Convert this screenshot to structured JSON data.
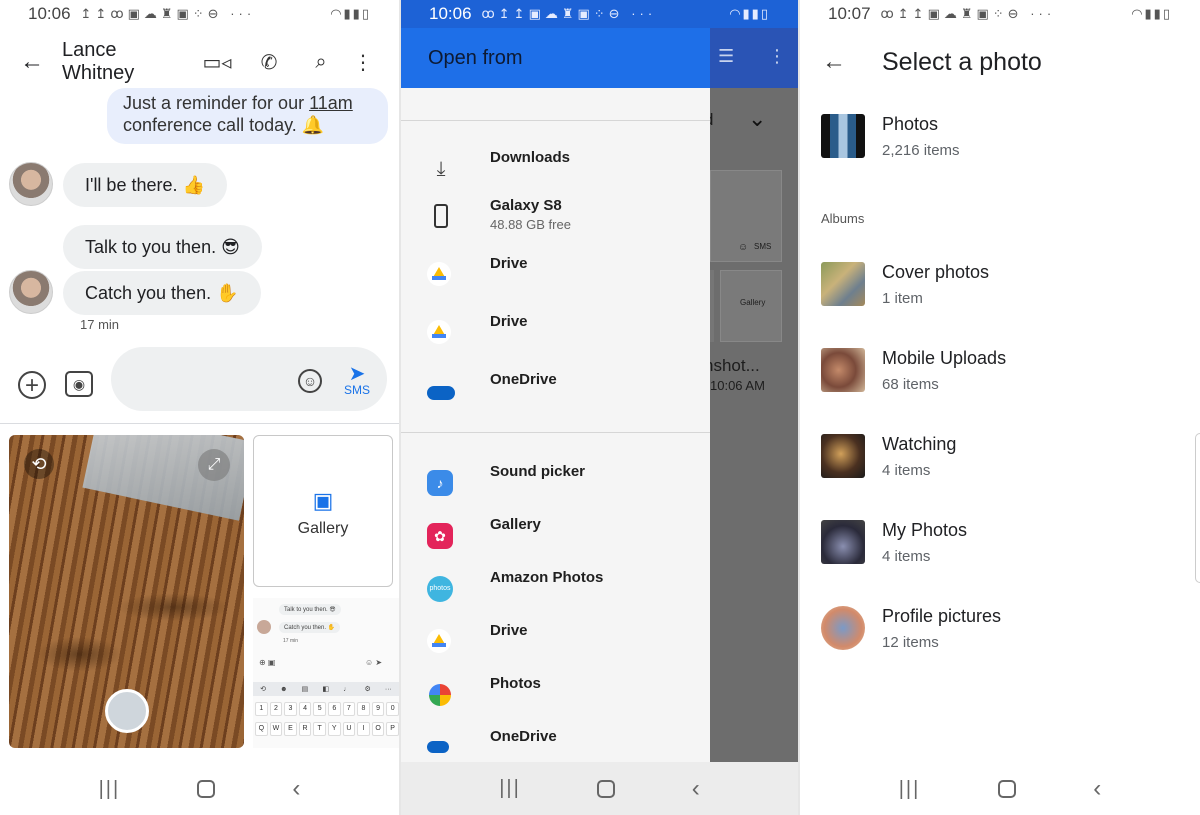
{
  "panel1": {
    "status": {
      "time": "10:06"
    },
    "contact_name": "Lance Whitney",
    "messages": {
      "outgoing_prefix": "Just a reminder for our ",
      "outgoing_link": "11am",
      "outgoing_line2": "conference call today. 🔔",
      "m1": "I'll be there. 👍",
      "m2": "Talk to you then. 😎",
      "m3": "Catch you then. ✋"
    },
    "timestamp": "17 min",
    "send_label": "SMS",
    "gallery_tile_label": "Gallery",
    "thumbnail": {
      "msg1": "Talk to you then. 😎",
      "msg2": "Catch you then. ✋",
      "ts": "17 min",
      "number_keys": [
        "1",
        "2",
        "3",
        "4",
        "5",
        "6",
        "7",
        "8",
        "9",
        "0"
      ],
      "letter_keys": [
        "Q",
        "W",
        "E",
        "R",
        "T",
        "Y",
        "U",
        "I",
        "O",
        "P"
      ]
    }
  },
  "panel2": {
    "status": {
      "time": "10:06"
    },
    "header_title": "Open from",
    "behind_fragments": {
      "d": "d",
      "shot": "nshot...",
      "time": "10:06 AM",
      "gallery": "Gallery",
      "sms": "SMS"
    },
    "items": [
      {
        "label": "Downloads",
        "sub": "",
        "icon": "download-icon"
      },
      {
        "label": "Galaxy S8",
        "sub": "48.88 GB free",
        "icon": "phone-icon"
      },
      {
        "label": "Drive",
        "sub": "",
        "icon": "drive-icon"
      },
      {
        "label": "Drive",
        "sub": "",
        "icon": "drive-icon"
      },
      {
        "label": "OneDrive",
        "sub": "",
        "icon": "onedrive-icon"
      },
      {
        "label": "Sound picker",
        "sub": "",
        "icon": "sound-picker-icon"
      },
      {
        "label": "Gallery",
        "sub": "",
        "icon": "gallery-icon"
      },
      {
        "label": "Amazon Photos",
        "sub": "",
        "icon": "amazon-photos-icon"
      },
      {
        "label": "Drive",
        "sub": "",
        "icon": "drive-icon"
      },
      {
        "label": "Photos",
        "sub": "",
        "icon": "google-photos-icon"
      },
      {
        "label": "OneDrive",
        "sub": "",
        "icon": "onedrive-icon"
      }
    ],
    "amazon_icon_text": "photos"
  },
  "panel3": {
    "status": {
      "time": "10:07"
    },
    "title": "Select a photo",
    "albums_label": "Albums",
    "top_item": {
      "name": "Photos",
      "count": "2,216 items"
    },
    "albums": [
      {
        "name": "Cover photos",
        "count": "1 item"
      },
      {
        "name": "Mobile Uploads",
        "count": "68 items"
      },
      {
        "name": "Watching",
        "count": "4 items"
      },
      {
        "name": "My Photos",
        "count": "4 items"
      },
      {
        "name": "Profile pictures",
        "count": "12 items"
      }
    ]
  },
  "colors": {
    "accent_blue": "#1a73e8",
    "drawer_header": "#1e6fe8",
    "outgoing_bubble": "#e8eefc",
    "incoming_bubble": "#eef0f1"
  }
}
